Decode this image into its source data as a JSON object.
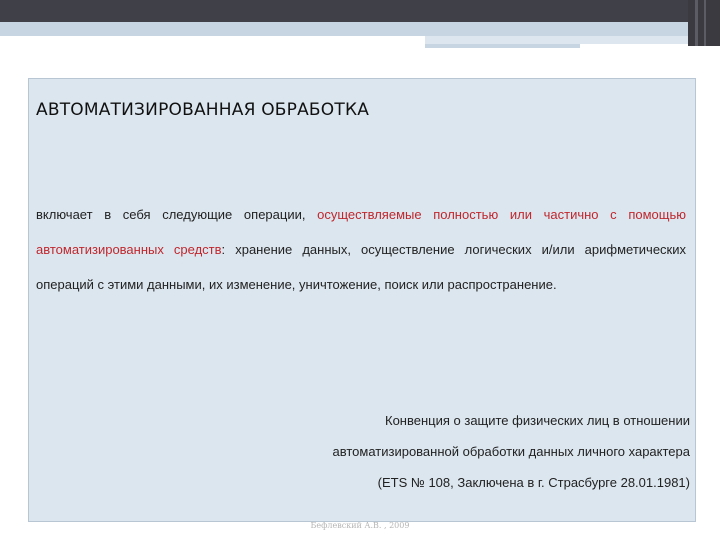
{
  "slide": {
    "title": "АВТОМАТИЗИРОВАННАЯ ОБРАБОТКА",
    "paragraph": {
      "lead": "включает в себя следующие операции, ",
      "highlight": "осуществляемые полностью или частично с помощью автоматизированных средств",
      "rest": ": хранение данных, осуществление логических и/или арифметических операций с этими данными, их изменение, уничтожение, поиск или распространение."
    },
    "source": {
      "line1": "Конвенция о защите физических лиц в отношении",
      "line2": "автоматизированной обработки данных личного характера",
      "line3": "(ETS № 108, Заключена в г. Страсбурге 28.01.1981)"
    },
    "footer": "Бефлевский А.В. , 2009"
  },
  "colors": {
    "highlight": "#c0272d",
    "content_bg": "#dce6ef",
    "top_bar": "#404048"
  }
}
